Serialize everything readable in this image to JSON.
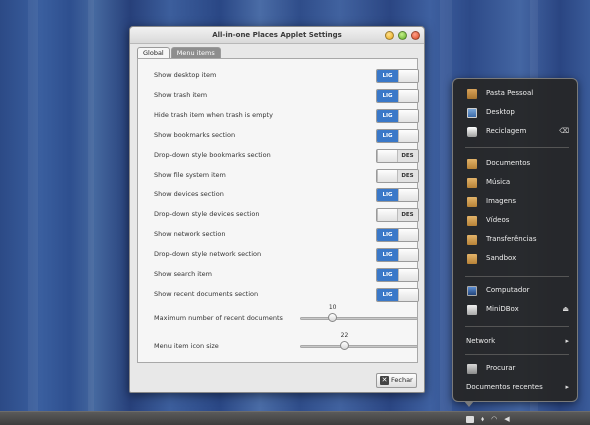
{
  "window": {
    "title": "All-in-one Places Applet Settings",
    "tabs": [
      {
        "label": "Global",
        "active": true
      },
      {
        "label": "Menu items",
        "active": false
      }
    ],
    "toggles": [
      {
        "label": "Show desktop item",
        "state": "LIG",
        "on": true
      },
      {
        "label": "Show trash item",
        "state": "LIG",
        "on": true
      },
      {
        "label": "Hide trash item when trash is empty",
        "state": "LIG",
        "on": true
      },
      {
        "label": "Show bookmarks section",
        "state": "LIG",
        "on": true
      },
      {
        "label": "Drop-down style bookmarks section",
        "state": "DES",
        "on": false
      },
      {
        "label": "Show file system item",
        "state": "DES",
        "on": false
      },
      {
        "label": "Show devices section",
        "state": "LIG",
        "on": true
      },
      {
        "label": "Drop-down style devices section",
        "state": "DES",
        "on": false
      },
      {
        "label": "Show network section",
        "state": "LIG",
        "on": true
      },
      {
        "label": "Drop-down style network section",
        "state": "LIG",
        "on": true
      },
      {
        "label": "Show search item",
        "state": "LIG",
        "on": true
      },
      {
        "label": "Show recent documents section",
        "state": "LIG",
        "on": true
      }
    ],
    "sliders": [
      {
        "label": "Maximum number of recent documents",
        "value": "10",
        "fraction": 0.27
      },
      {
        "label": "Menu item icon size",
        "value": "22",
        "fraction": 0.37
      }
    ],
    "close_label": "Fechar"
  },
  "menu": {
    "places": [
      {
        "label": "Pasta Pessoal",
        "icon": "home-folder-icon"
      },
      {
        "label": "Desktop",
        "icon": "desktop-icon"
      },
      {
        "label": "Reciclagem",
        "icon": "trash-icon",
        "side": "⌫"
      }
    ],
    "bookmarks": [
      {
        "label": "Documentos",
        "icon": "folder-icon"
      },
      {
        "label": "Música",
        "icon": "folder-icon"
      },
      {
        "label": "Imagens",
        "icon": "folder-icon"
      },
      {
        "label": "Vídeos",
        "icon": "folder-icon"
      },
      {
        "label": "Transferências",
        "icon": "folder-icon"
      },
      {
        "label": "Sandbox",
        "icon": "folder-icon"
      }
    ],
    "devices": [
      {
        "label": "Computador",
        "icon": "computer-icon"
      },
      {
        "label": "MiniDBox",
        "icon": "drive-icon",
        "side": "⏏"
      }
    ],
    "network": {
      "label": "Network",
      "arrow": "▸"
    },
    "search": {
      "label": "Procurar",
      "icon": "search-icon"
    },
    "recent": {
      "label": "Documentos recentes",
      "arrow": "▸"
    }
  },
  "colors": {
    "toggle_on": "#3a78c8",
    "desktop_bg": "#2c4a86"
  }
}
